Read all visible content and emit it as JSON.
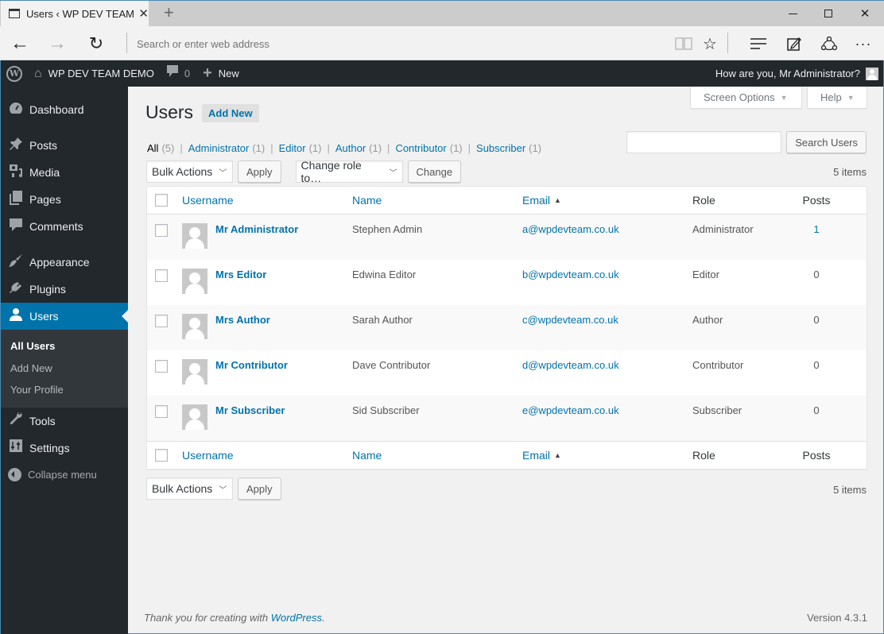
{
  "browser": {
    "tab_title": "Users ‹ WP DEV TEAM DEMO — WordPress",
    "tab_title_visible": "Users ‹ WP DEV TEAM D",
    "address_placeholder": "Search or enter web address",
    "icons": {
      "back": "←",
      "forward": "→",
      "refresh": "↻",
      "reading": "📖",
      "favorite": "☆",
      "hub": "≡",
      "note": "✎",
      "share": "⟁",
      "more": "···",
      "close_tab": "✕",
      "new_tab": "+",
      "close_window": "✕"
    }
  },
  "adminbar": {
    "site_name": "WP DEV TEAM DEMO",
    "comments_count": "0",
    "new_label": "New",
    "greeting": "How are you, Mr Administrator?",
    "wp_logo": "W",
    "home_icon": "⌂",
    "comment_icon": "▮",
    "plus_icon": "+"
  },
  "sidebar": {
    "items": [
      {
        "label": "Dashboard",
        "icon": "◔"
      },
      {
        "label": "Posts",
        "icon": "✎"
      },
      {
        "label": "Media",
        "icon": "▣"
      },
      {
        "label": "Pages",
        "icon": "▤"
      },
      {
        "label": "Comments",
        "icon": "▮"
      },
      {
        "label": "Appearance",
        "icon": "✐"
      },
      {
        "label": "Plugins",
        "icon": "⚡"
      },
      {
        "label": "Users",
        "icon": "●"
      },
      {
        "label": "Tools",
        "icon": "✦"
      },
      {
        "label": "Settings",
        "icon": "⇅"
      }
    ],
    "submenu": [
      "All Users",
      "Add New",
      "Your Profile"
    ],
    "collapse_label": "Collapse menu"
  },
  "screen_meta": {
    "screen_options": "Screen Options",
    "help": "Help",
    "caret": "▼"
  },
  "page": {
    "title": "Users",
    "add_new": "Add New"
  },
  "filters": [
    {
      "label": "All",
      "count": "(5)"
    },
    {
      "label": "Administrator",
      "count": "(1)"
    },
    {
      "label": "Editor",
      "count": "(1)"
    },
    {
      "label": "Author",
      "count": "(1)"
    },
    {
      "label": "Contributor",
      "count": "(1)"
    },
    {
      "label": "Subscriber",
      "count": "(1)"
    }
  ],
  "filter_separator": "|",
  "search": {
    "value": "",
    "button": "Search Users"
  },
  "tablenav": {
    "bulk_actions": "Bulk Actions",
    "apply": "Apply",
    "change_role": "Change role to…",
    "change": "Change",
    "items_count": "5 items",
    "chevron": "﹀"
  },
  "table": {
    "columns": {
      "username": "Username",
      "name": "Name",
      "email": "Email",
      "role": "Role",
      "posts": "Posts",
      "sort_indicator": "▲"
    },
    "rows": [
      {
        "username": "Mr Administrator",
        "name": "Stephen Admin",
        "email": "a@wpdevteam.co.uk",
        "role": "Administrator",
        "posts": "1"
      },
      {
        "username": "Mrs Editor",
        "name": "Edwina Editor",
        "email": "b@wpdevteam.co.uk",
        "role": "Editor",
        "posts": "0"
      },
      {
        "username": "Mrs Author",
        "name": "Sarah Author",
        "email": "c@wpdevteam.co.uk",
        "role": "Author",
        "posts": "0"
      },
      {
        "username": "Mr Contributor",
        "name": "Dave Contributor",
        "email": "d@wpdevteam.co.uk",
        "role": "Contributor",
        "posts": "0"
      },
      {
        "username": "Mr Subscriber",
        "name": "Sid Subscriber",
        "email": "e@wpdevteam.co.uk",
        "role": "Subscriber",
        "posts": "0"
      }
    ]
  },
  "footer": {
    "thanks_prefix": "Thank you for creating with ",
    "thanks_link": "WordPress",
    "thanks_suffix": ".",
    "version": "Version 4.3.1"
  },
  "colors": {
    "accent": "#0073aa",
    "adminbar_bg": "#23282d",
    "submenu_bg": "#32373c",
    "page_bg": "#f1f1f1"
  }
}
